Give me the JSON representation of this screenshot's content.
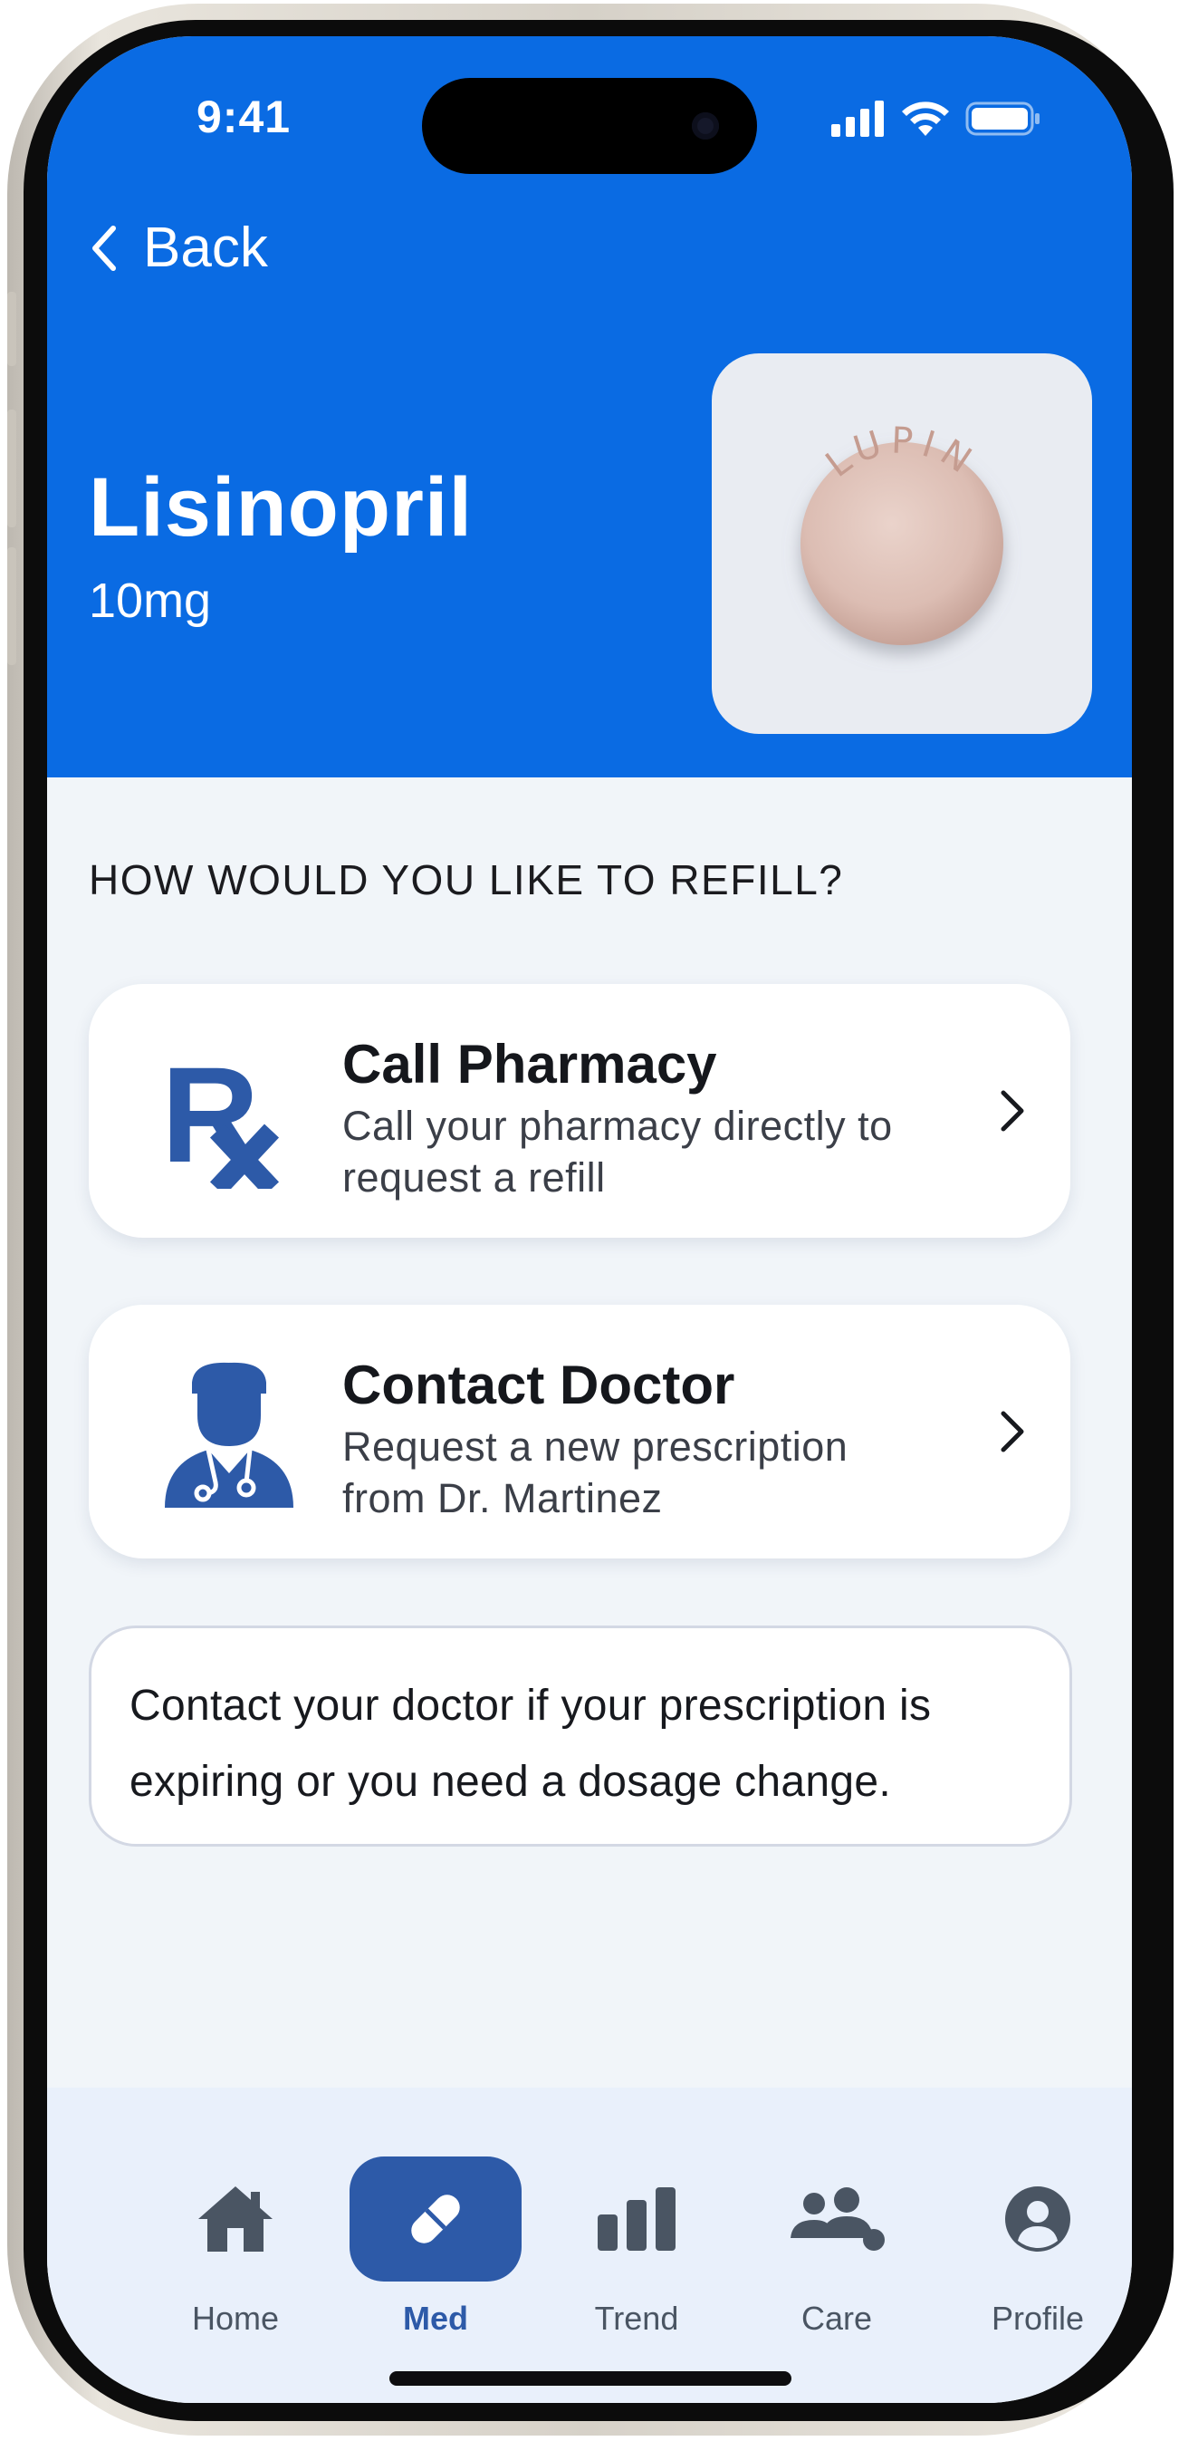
{
  "status_bar": {
    "time": "9:41"
  },
  "header": {
    "back_label": "Back",
    "drug_name": "Lisinopril",
    "dose": "10mg",
    "pill_imprint": "LUPIN"
  },
  "section_title": "HOW WOULD YOU LIKE TO REFILL?",
  "options": [
    {
      "title": "Call Pharmacy",
      "description": "Call your pharmacy directly to request a refill",
      "icon": "rx-icon"
    },
    {
      "title": "Contact Doctor",
      "description": "Request a new prescription from Dr. Martinez",
      "icon": "doctor-icon"
    }
  ],
  "info_note": "Contact your doctor if your prescription is expiring or you need a dosage change.",
  "tabbar": {
    "items": [
      {
        "label": "Home",
        "icon": "home-icon",
        "active": false
      },
      {
        "label": "Med",
        "icon": "pill-icon",
        "active": true
      },
      {
        "label": "Trend",
        "icon": "bar-chart-icon",
        "active": false
      },
      {
        "label": "Care",
        "icon": "people-icon",
        "active": false
      },
      {
        "label": "Profile",
        "icon": "user-circle-icon",
        "active": false
      }
    ]
  },
  "colors": {
    "header_blue": "#0a6be3",
    "accent_navy": "#2d5aa8",
    "background": "#f1f5f9",
    "tab_inactive": "#4a5563"
  }
}
